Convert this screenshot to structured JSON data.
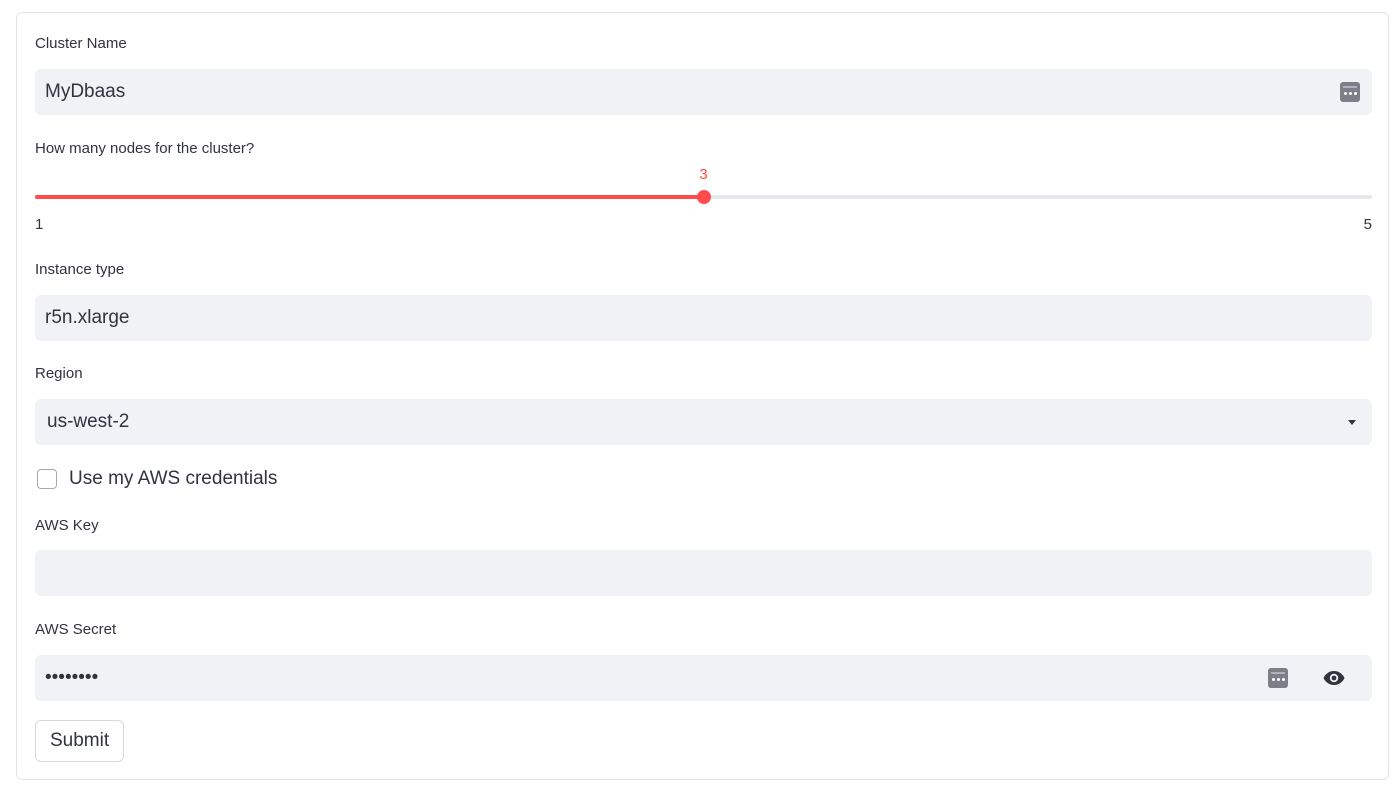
{
  "form": {
    "cluster_name": {
      "label": "Cluster Name",
      "value": "MyDbaas"
    },
    "nodes": {
      "label": "How many nodes for the cluster?",
      "min": 1,
      "max": 5,
      "value": 3,
      "min_label": "1",
      "max_label": "5",
      "value_label": "3"
    },
    "instance_type": {
      "label": "Instance type",
      "value": "r5n.xlarge"
    },
    "region": {
      "label": "Region",
      "selected": "us-west-2"
    },
    "use_credentials": {
      "label": "Use my AWS credentials",
      "checked": false
    },
    "aws_key": {
      "label": "AWS Key",
      "value": ""
    },
    "aws_secret": {
      "label": "AWS Secret",
      "masked_value": "••••••••"
    },
    "submit_label": "Submit"
  },
  "colors": {
    "accent": "#ff4b4b",
    "input_bg": "#f0f2f6",
    "text": "#31333f"
  },
  "icons": {
    "cluster_name_action": "password-manager-icon",
    "region_dropdown": "caret-down-icon",
    "secret_action": "password-manager-icon",
    "secret_toggle": "eye-icon"
  }
}
